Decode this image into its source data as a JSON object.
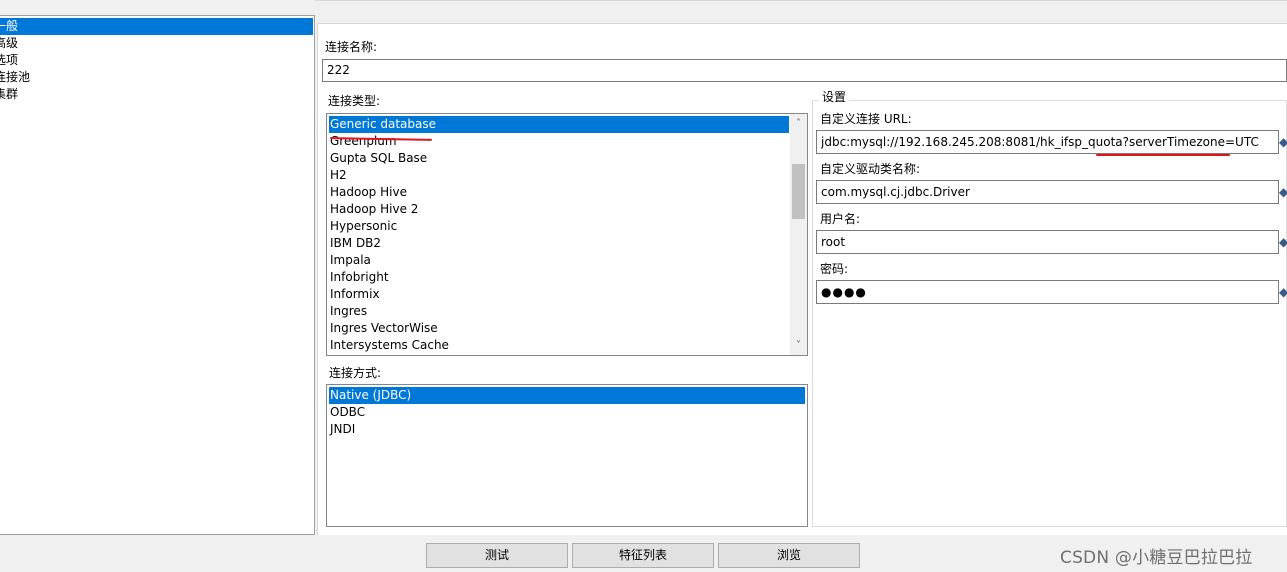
{
  "nav": {
    "items": [
      {
        "label": "一般",
        "selected": true
      },
      {
        "label": "高级",
        "selected": false
      },
      {
        "label": "选项",
        "selected": false
      },
      {
        "label": "连接池",
        "selected": false
      },
      {
        "label": "集群",
        "selected": false
      }
    ]
  },
  "connection_name": {
    "label": "连接名称:",
    "value": "222"
  },
  "connection_type": {
    "label": "连接类型:",
    "items": [
      "Generic database",
      "Greenplum",
      "Gupta SQL Base",
      "H2",
      "Hadoop Hive",
      "Hadoop Hive 2",
      "Hypersonic",
      "IBM DB2",
      "Impala",
      "Infobright",
      "Informix",
      "Ingres",
      "Ingres VectorWise",
      "Intersystems Cache"
    ],
    "selected": "Generic database"
  },
  "access_method": {
    "label": "连接方式:",
    "items": [
      "Native (JDBC)",
      "ODBC",
      "JNDI"
    ],
    "selected": "Native (JDBC)"
  },
  "settings": {
    "group_label": "设置",
    "url_label": "自定义连接 URL:",
    "url_value": "jdbc:mysql://192.168.245.208:8081/hk_ifsp_quota?serverTimezone=UTC",
    "driver_label": "自定义驱动类名称:",
    "driver_value": "com.mysql.cj.jdbc.Driver",
    "user_label": "用户名:",
    "user_value": "root",
    "password_label": "密码:",
    "password_value": "●●●●"
  },
  "buttons": {
    "test": "测试",
    "features": "特征列表",
    "browse": "浏览"
  },
  "watermark": "CSDN @小糖豆巴拉巴拉",
  "colors": {
    "selection": "#0078d7",
    "annotation": "#e0141e"
  }
}
